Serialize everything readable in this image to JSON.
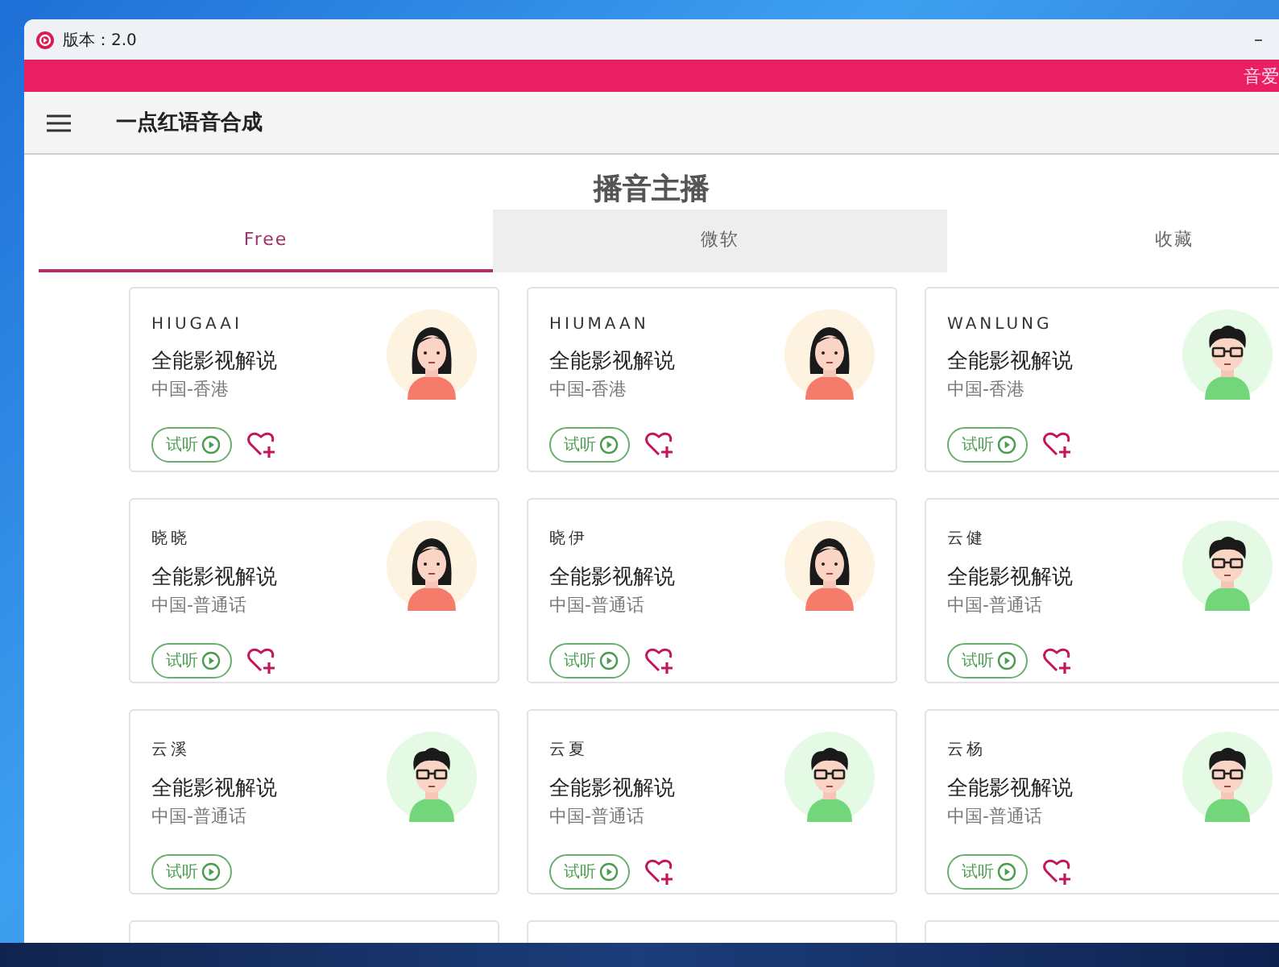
{
  "window": {
    "title": "版本：2.0",
    "minimize": "–"
  },
  "banner": {
    "text": "音爱"
  },
  "app_bar": {
    "title": "一点红语音合成"
  },
  "page": {
    "heading": "播音主播"
  },
  "tabs": [
    {
      "label": "Free",
      "selected": true,
      "hovered": false
    },
    {
      "label": "微软",
      "selected": false,
      "hovered": true
    },
    {
      "label": "收藏",
      "selected": false,
      "hovered": false
    }
  ],
  "voices": [
    {
      "name": "HIUGAAI",
      "style": "全能影视解说",
      "locale": "中国-香港",
      "kind": "female",
      "preview": "试听",
      "favorite_shown": true
    },
    {
      "name": "HIUMAAN",
      "style": "全能影视解说",
      "locale": "中国-香港",
      "kind": "female",
      "preview": "试听",
      "favorite_shown": true
    },
    {
      "name": "WANLUNG",
      "style": "全能影视解说",
      "locale": "中国-香港",
      "kind": "male",
      "preview": "试听",
      "favorite_shown": true
    },
    {
      "name": "晓晓",
      "style": "全能影视解说",
      "locale": "中国-普通话",
      "kind": "female",
      "preview": "试听",
      "favorite_shown": true
    },
    {
      "name": "晓伊",
      "style": "全能影视解说",
      "locale": "中国-普通话",
      "kind": "female",
      "preview": "试听",
      "favorite_shown": true
    },
    {
      "name": "云健",
      "style": "全能影视解说",
      "locale": "中国-普通话",
      "kind": "male",
      "preview": "试听",
      "favorite_shown": true
    },
    {
      "name": "云溪",
      "style": "全能影视解说",
      "locale": "中国-普通话",
      "kind": "male",
      "preview": "试听",
      "favorite_shown": false
    },
    {
      "name": "云夏",
      "style": "全能影视解说",
      "locale": "中国-普通话",
      "kind": "male",
      "preview": "试听",
      "favorite_shown": true
    },
    {
      "name": "云杨",
      "style": "全能影视解说",
      "locale": "中国-普通话",
      "kind": "male",
      "preview": "试听",
      "favorite_shown": true
    }
  ]
}
